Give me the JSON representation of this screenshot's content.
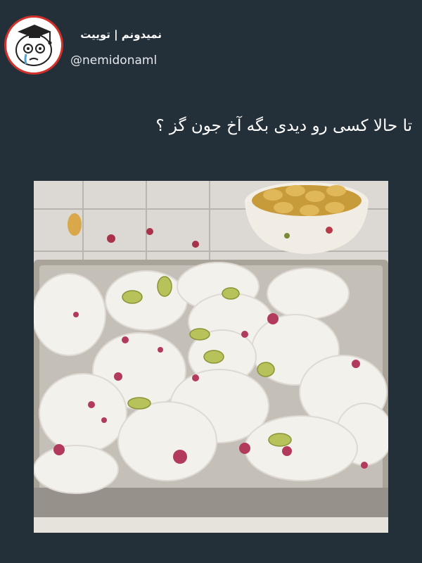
{
  "tweet": {
    "display_name": "نمیدونم | توییت",
    "handle": "@nemidonaml",
    "text": "تا حالا کسی رو دیدی بگه آخ جون گز ؟"
  },
  "photo": {
    "subject": "gaz-nougat-with-pistachios-and-rose-petals"
  },
  "icons": {
    "avatar": "cartoon-face-graduation-cap-icon"
  },
  "colors": {
    "background": "#243039",
    "avatar_border": "#d2302a",
    "text": "#ffffff"
  }
}
